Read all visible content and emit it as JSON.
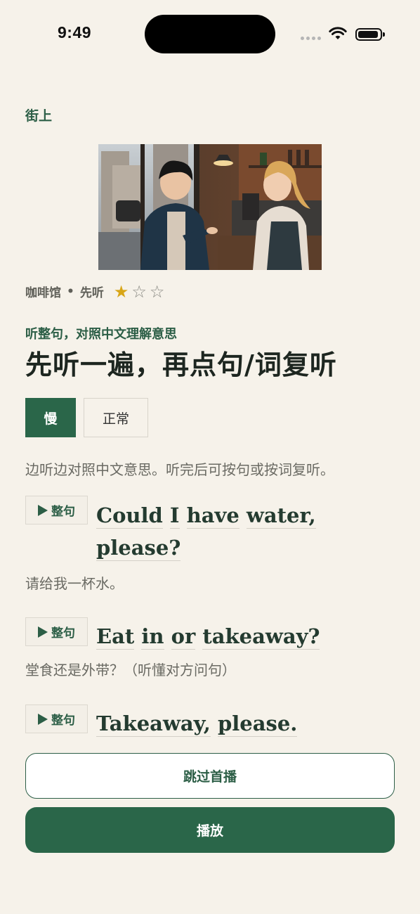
{
  "status_bar": {
    "time": "9:49"
  },
  "location": "街上",
  "lesson": {
    "place": "咖啡馆",
    "separator": "•",
    "mode": "先听",
    "stars_filled": 1,
    "stars_total": 3
  },
  "subtitle": "听整句，对照中文理解意思",
  "title": "先听一遍，再点句/词复听",
  "speed": {
    "slow": "慢",
    "normal": "正常",
    "selected": "慢"
  },
  "hint": "边听边对照中文意思。听完后可按句或按词复听。",
  "play_sentence_label": "整句",
  "sentences": [
    {
      "words": [
        "Could",
        "I",
        "have",
        "water,",
        "please?"
      ],
      "translation": "请给我一杯水。"
    },
    {
      "words": [
        "Eat",
        "in",
        "or",
        "takeaway?"
      ],
      "translation": "堂食还是外带？（听懂对方问句）"
    },
    {
      "words": [
        "Takeaway,",
        "please."
      ],
      "translation": ""
    }
  ],
  "buttons": {
    "skip": "跳过首播",
    "play": "播放"
  },
  "colors": {
    "accent": "#2a6649",
    "background": "#f6f2ea",
    "star": "#d8a618"
  },
  "icons": {
    "play": "play-icon",
    "star": "star-icon",
    "wifi": "wifi-icon",
    "battery": "battery-icon"
  }
}
